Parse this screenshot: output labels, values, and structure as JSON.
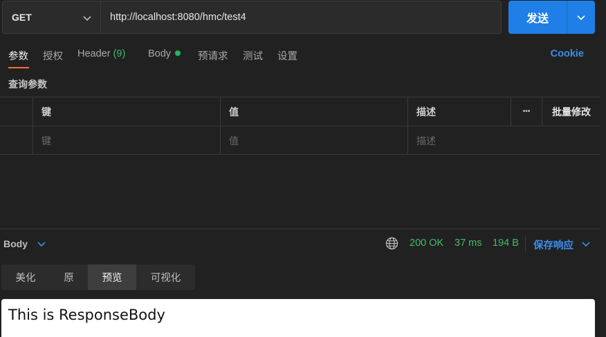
{
  "request": {
    "method": "GET",
    "url": "http://localhost:8080/hmc/test4",
    "send_label": "发送"
  },
  "request_tabs": {
    "params": "参数",
    "auth": "授权",
    "header": "Header",
    "header_count": "(9)",
    "body": "Body",
    "prerequest": "预请求",
    "tests": "测试",
    "settings": "设置",
    "cookie": "Cookie"
  },
  "params": {
    "section_title": "查询参数",
    "columns": {
      "key": "键",
      "value": "值",
      "description": "描述",
      "more": "•••",
      "bulk_edit": "批量修改"
    },
    "placeholders": {
      "key": "键",
      "value": "值",
      "description": "描述"
    }
  },
  "response": {
    "body_label": "Body",
    "status": "200 OK",
    "time": "37 ms",
    "size": "194 B",
    "save_label": "保存响应",
    "view_tabs": [
      "美化",
      "原",
      "预览",
      "可视化"
    ],
    "active_view": "预览",
    "preview_text": "This is ResponseBody"
  },
  "colors": {
    "accent_orange": "#ff6c37",
    "link_blue": "#3b8eea",
    "send_blue": "#1f7fe6",
    "status_green": "#3fbf6a"
  },
  "icons": [
    "chevron-down-icon",
    "globe-icon",
    "more-horizontal-icon"
  ]
}
